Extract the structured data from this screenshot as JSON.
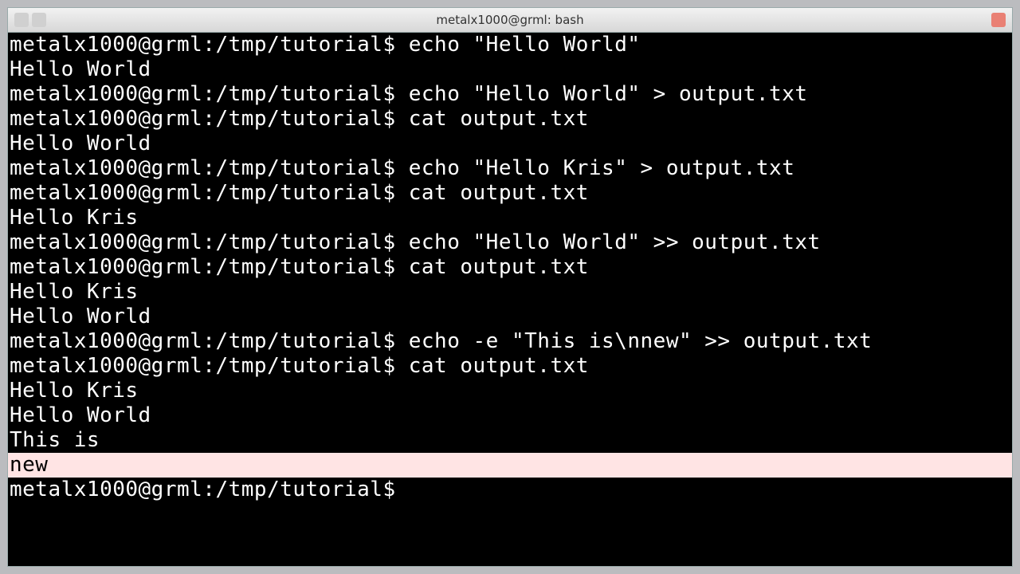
{
  "window": {
    "title": "metalx1000@grml: bash"
  },
  "prompt": "metalx1000@grml:/tmp/tutorial$",
  "lines": {
    "l0": "metalx1000@grml:/tmp/tutorial$ echo \"Hello World\"",
    "l1": "Hello World",
    "l2": "metalx1000@grml:/tmp/tutorial$ echo \"Hello World\" > output.txt",
    "l3": "metalx1000@grml:/tmp/tutorial$ cat output.txt",
    "l4": "Hello World",
    "l5": "metalx1000@grml:/tmp/tutorial$ echo \"Hello Kris\" > output.txt",
    "l6": "metalx1000@grml:/tmp/tutorial$ cat output.txt",
    "l7": "Hello Kris",
    "l8": "metalx1000@grml:/tmp/tutorial$ echo \"Hello World\" >> output.txt",
    "l9": "metalx1000@grml:/tmp/tutorial$ cat output.txt",
    "l10": "Hello Kris",
    "l11": "Hello World",
    "l12": "metalx1000@grml:/tmp/tutorial$ echo -e \"This is\\nnew\" >> output.txt",
    "l13": "metalx1000@grml:/tmp/tutorial$ cat output.txt",
    "l14": "Hello Kris",
    "l15": "Hello World",
    "l16": "This is",
    "l17": "new",
    "l18": "metalx1000@grml:/tmp/tutorial$ "
  }
}
